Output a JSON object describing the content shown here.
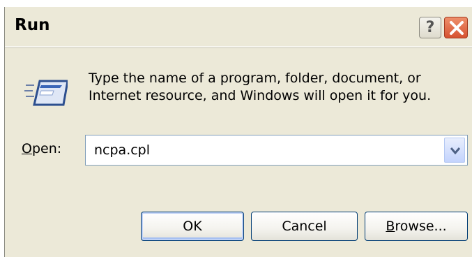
{
  "window": {
    "title": "Run",
    "help_button_label": "?",
    "close_button_label": "close"
  },
  "dialog": {
    "description": "Type the name of a program, folder, document, or Internet resource, and Windows will open it for you.",
    "open_label_accel": "O",
    "open_label_rest": "pen:",
    "open_value": "ncpa.cpl"
  },
  "buttons": {
    "ok": "OK",
    "cancel": "Cancel",
    "browse_accel": "B",
    "browse_rest": "rowse..."
  },
  "icons": {
    "app": "run-program-icon",
    "help": "help-icon",
    "close": "close-icon",
    "dropdown": "chevron-down-icon"
  },
  "colors": {
    "dialog_face": "#ece9d8",
    "close_red": "#d65331",
    "input_border": "#7f9db9",
    "button_border": "#003c74"
  }
}
